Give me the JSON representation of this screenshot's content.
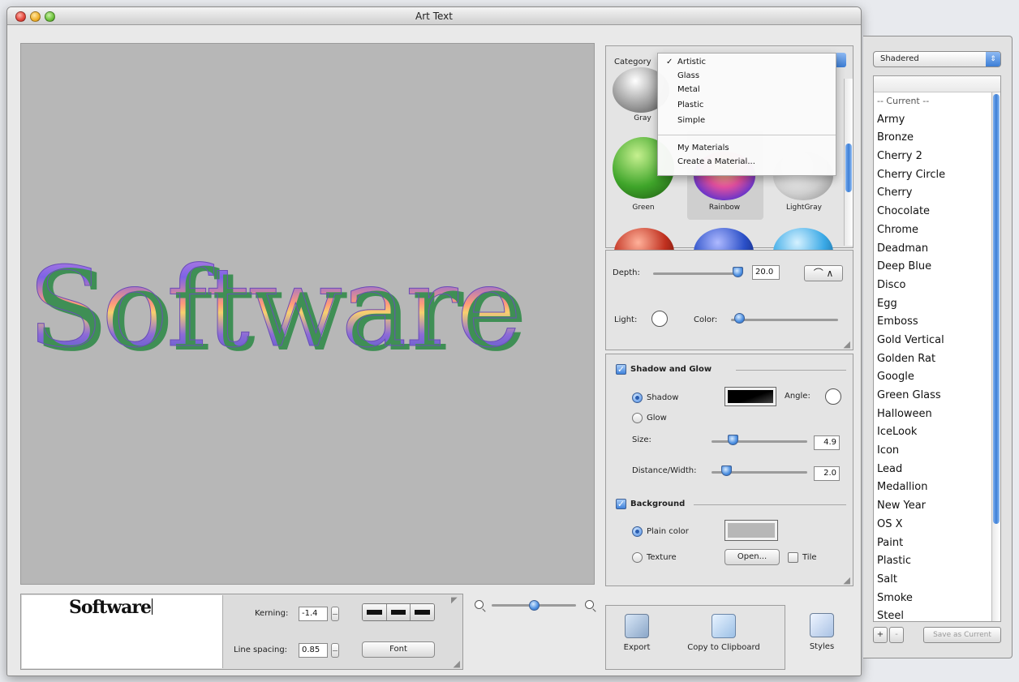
{
  "window": {
    "title": "Art Text"
  },
  "canvas": {
    "art_text": "Software",
    "background": "#b7b7b7"
  },
  "editor": {
    "text": "Software",
    "kerning_label": "Kerning:",
    "kerning_value": "-1.4",
    "line_spacing_label": "Line spacing:",
    "line_spacing_value": "0.85",
    "font_button": "Font"
  },
  "zoom": {
    "level_fraction": 0.42
  },
  "materials": {
    "category_label": "Category",
    "swatches": [
      {
        "label": "Gray",
        "color": "#9a9a9a"
      },
      {
        "label": "Green",
        "color": "#3fa52a"
      },
      {
        "label": "Rainbow",
        "color": "#e4509e"
      },
      {
        "label": "LightGray",
        "color": "#d0d0d0"
      },
      {
        "label": "",
        "color": "#c0301f"
      },
      {
        "label": "",
        "color": "#2a4fc7"
      },
      {
        "label": "",
        "color": "#3aa9e6"
      }
    ]
  },
  "category_menu": {
    "items": [
      "Artistic",
      "Glass",
      "Metal",
      "Plastic",
      "Simple"
    ],
    "selected": "Artistic",
    "extra_items": [
      "My Materials",
      "Create a Material..."
    ]
  },
  "depth": {
    "depth_label": "Depth:",
    "depth_value": "20.0",
    "light_label": "Light:",
    "color_label": "Color:"
  },
  "shadow_glow": {
    "title": "Shadow and Glow",
    "shadow_label": "Shadow",
    "glow_label": "Glow",
    "angle_label": "Angle:",
    "size_label": "Size:",
    "size_value": "4.9",
    "distance_label": "Distance/Width:",
    "distance_value": "2.0",
    "shadow_color": "#000000"
  },
  "background": {
    "title": "Background",
    "plain_color_label": "Plain color",
    "texture_label": "Texture",
    "open_button": "Open...",
    "tile_label": "Tile",
    "plain_color": "#b7b7b7"
  },
  "toolbar": {
    "export_label": "Export",
    "copy_label": "Copy to Clipboard",
    "styles_label": "Styles"
  },
  "styles_drawer": {
    "popup_value": "Shadered",
    "current_label": "-- Current --",
    "items": [
      "Army",
      "Bronze",
      "Cherry 2",
      "Cherry Circle",
      "Cherry",
      "Chocolate",
      "Chrome",
      "Deadman",
      "Deep Blue",
      "Disco",
      "Egg",
      "Emboss",
      "Gold Vertical",
      "Golden Rat",
      "Google",
      "Green Glass",
      "Halloween",
      "IceLook",
      "Icon",
      "Lead",
      "Medallion",
      "New Year",
      "OS X",
      "Paint",
      "Plastic",
      "Salt",
      "Smoke",
      "Steel"
    ],
    "add_label": "+",
    "remove_label": "-",
    "save_label": "Save as Current"
  }
}
